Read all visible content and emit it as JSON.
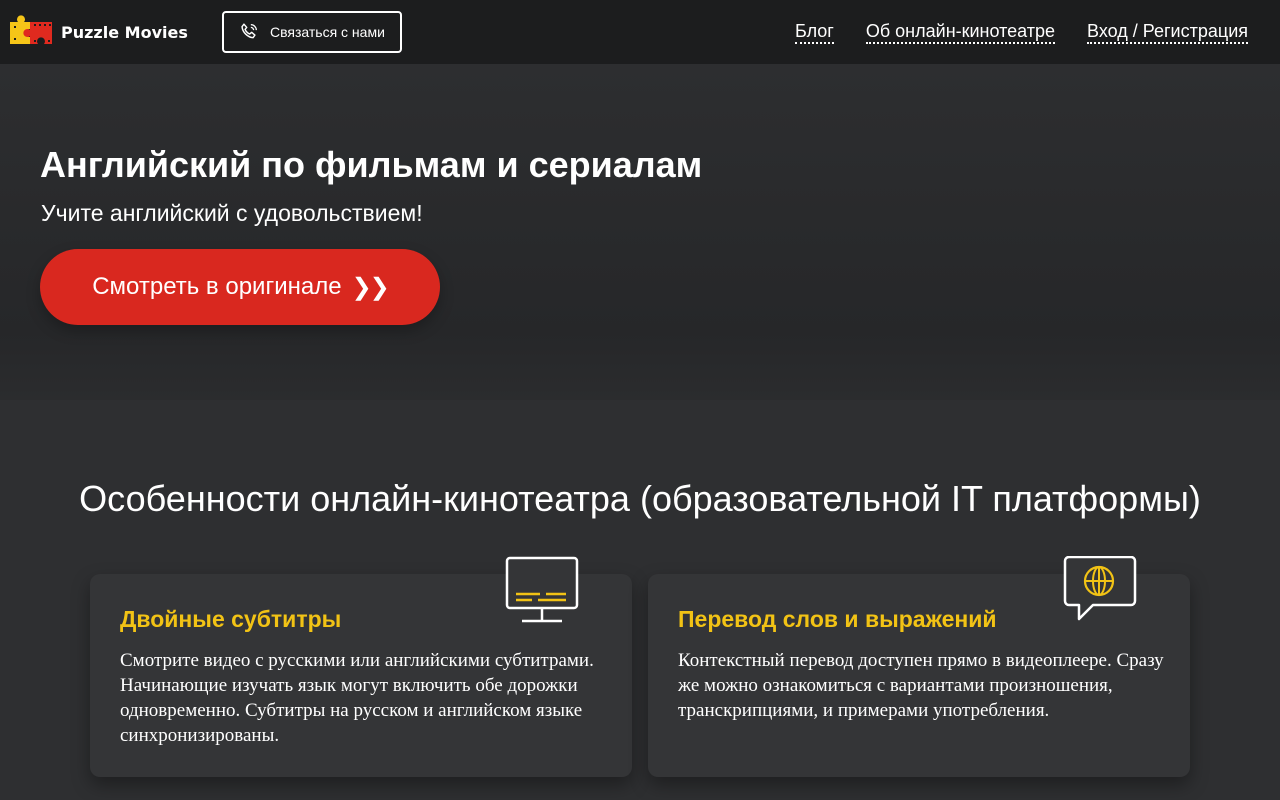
{
  "header": {
    "brand": "Puzzle Movies",
    "contact_label": "Связаться с нами",
    "nav": [
      {
        "label": "Блог"
      },
      {
        "label": "Об онлайн-кинотеатре"
      },
      {
        "label": "Вход / Регистрация"
      }
    ],
    "icons": {
      "logo": "puzzle-film-logo",
      "contact": "phone-icon"
    }
  },
  "hero": {
    "title": "Английский по фильмам и сериалам",
    "subtitle": "Учите английский с удовольствием!",
    "cta_label": "Смотреть в оригинале",
    "cta_icon": "❯❯"
  },
  "features": {
    "title": "Особенности онлайн-кинотеатра (образовательной IT платформы)",
    "cards": [
      {
        "icon": "monitor-subtitles-icon",
        "title": "Двойные субтитры",
        "text": "Смотрите видео с русскими или английскими субтитрами. Начинающие изучать язык могут включить обе дорожки одновременно. Субтитры на русском и английском языке синхронизированы."
      },
      {
        "icon": "speech-bubble-globe-icon",
        "title": "Перевод слов и выражений",
        "text": "Контекстный перевод доступен прямо в видеоплеере. Сразу же можно ознакомиться с вариантами произношения, транскрипциями, и примерами употребления."
      }
    ]
  },
  "colors": {
    "accent_red": "#d9281f",
    "accent_yellow": "#f2c315",
    "topbar_bg": "#1c1d1e",
    "card_bg": "#343537"
  }
}
